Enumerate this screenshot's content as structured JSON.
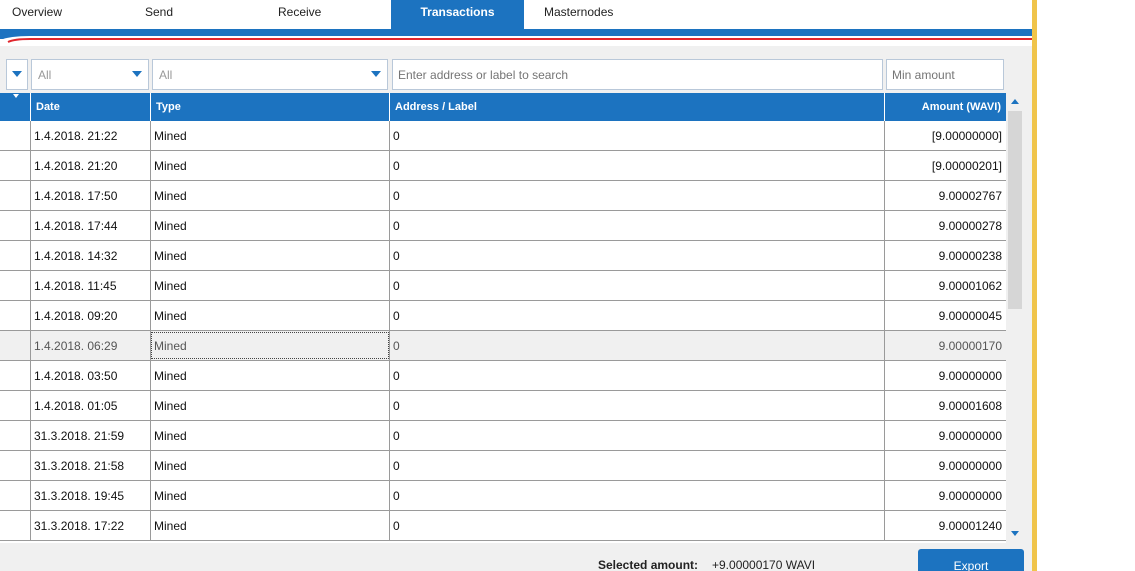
{
  "nav": {
    "tabs": [
      {
        "label": "Overview"
      },
      {
        "label": "Send"
      },
      {
        "label": "Receive"
      },
      {
        "label": "Transactions"
      },
      {
        "label": "Masternodes"
      }
    ],
    "active_tab": "Transactions"
  },
  "filters": {
    "date_value": "All",
    "type_value": "All",
    "search_placeholder": "Enter address or label to search",
    "min_amount_placeholder": "Min amount"
  },
  "table": {
    "columns": [
      "Date",
      "Type",
      "Address / Label",
      "Amount (WAVI)"
    ],
    "rows": [
      {
        "date": "1.4.2018. 21:22",
        "type": "Mined",
        "address": "0",
        "amount": "[9.00000000]"
      },
      {
        "date": "1.4.2018. 21:20",
        "type": "Mined",
        "address": "0",
        "amount": "[9.00000201]"
      },
      {
        "date": "1.4.2018. 17:50",
        "type": "Mined",
        "address": "0",
        "amount": "9.00002767"
      },
      {
        "date": "1.4.2018. 17:44",
        "type": "Mined",
        "address": "0",
        "amount": "9.00000278"
      },
      {
        "date": "1.4.2018. 14:32",
        "type": "Mined",
        "address": "0",
        "amount": "9.00000238"
      },
      {
        "date": "1.4.2018. 11:45",
        "type": "Mined",
        "address": "0",
        "amount": "9.00001062"
      },
      {
        "date": "1.4.2018. 09:20",
        "type": "Mined",
        "address": "0",
        "amount": "9.00000045"
      },
      {
        "date": "1.4.2018. 06:29",
        "type": "Mined",
        "address": "0",
        "amount": "9.00000170"
      },
      {
        "date": "1.4.2018. 03:50",
        "type": "Mined",
        "address": "0",
        "amount": "9.00000000"
      },
      {
        "date": "1.4.2018. 01:05",
        "type": "Mined",
        "address": "0",
        "amount": "9.00001608"
      },
      {
        "date": "31.3.2018. 21:59",
        "type": "Mined",
        "address": "0",
        "amount": "9.00000000"
      },
      {
        "date": "31.3.2018. 21:58",
        "type": "Mined",
        "address": "0",
        "amount": "9.00000000"
      },
      {
        "date": "31.3.2018. 19:45",
        "type": "Mined",
        "address": "0",
        "amount": "9.00000000"
      },
      {
        "date": "31.3.2018. 17:22",
        "type": "Mined",
        "address": "0",
        "amount": "9.00001240"
      }
    ],
    "selected_row": 7
  },
  "footer": {
    "selected_label": "Selected amount:",
    "selected_value": "+9.00000170 WAVI",
    "export_label": "Export"
  },
  "colors": {
    "accent": "#1c73c0",
    "stripe": "#e0262d",
    "border_gold": "#f0c44a"
  }
}
